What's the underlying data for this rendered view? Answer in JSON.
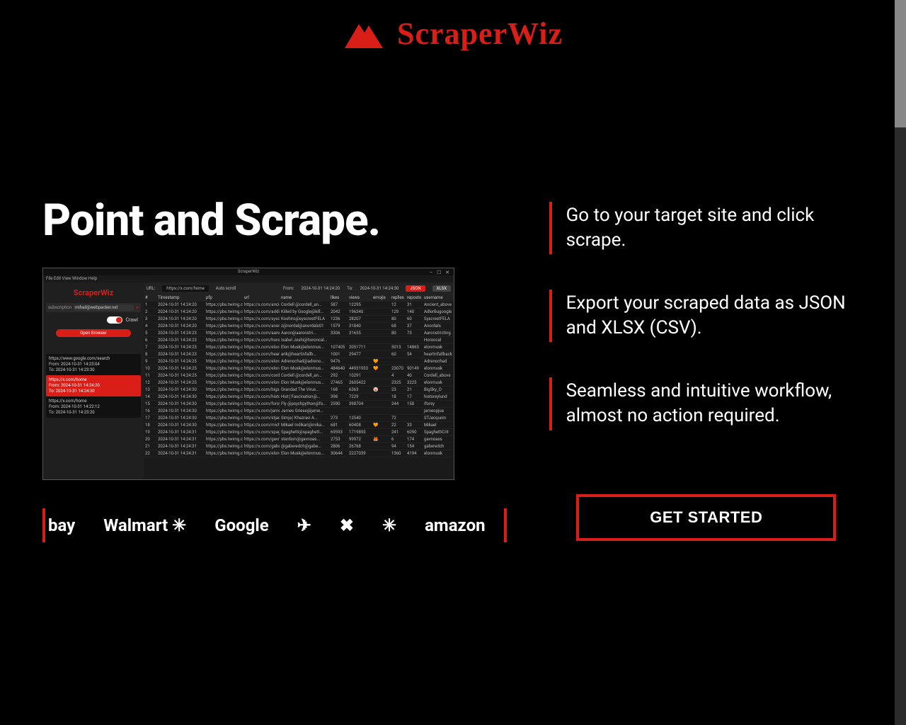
{
  "brand": {
    "name": "ScraperWiz"
  },
  "hero": {
    "title": "Point and Scrape."
  },
  "features": [
    "Go to your target site and click scrape.",
    "Export your scraped data as JSON and XLSX (CSV).",
    "Seamless and intuitive workflow, almost no action required."
  ],
  "cta": {
    "label": "GET STARTED"
  },
  "brands": [
    "bay",
    "Walmart ✳",
    "Google",
    "✈",
    "✖",
    "✳",
    "amazon"
  ],
  "screenshot": {
    "title": "ScraperWiz",
    "menubar": "File  Edit  View  Window  Help",
    "sidebar": {
      "logo": "ScraperWiz",
      "subscription_label": "subscription",
      "subscription_value": "mihail@webpacker.net",
      "toggle_label": "Crawl",
      "open_button": "Open Browser",
      "cards": [
        {
          "url": "https://www.google.com/search",
          "from": "From: 2024-10-31 14:23:04",
          "to": "To: 2024-10-31 14:23:30"
        },
        {
          "url": "https://x.com/home",
          "from": "From: 2024-10-31 14:24:20",
          "to": "To: 2024-10-31 14:24:30"
        },
        {
          "url": "https://x.com/home",
          "from": "From: 2024-10-31 14:22:12",
          "to": "To: 2024-10-31 14:23:20"
        }
      ]
    },
    "toolbar": {
      "url_label": "URL:",
      "url": "https://x.com/home",
      "auto_label": "Auto scroll",
      "from_label": "From:",
      "from": "2024-10-31 14:24:20",
      "to_label": "To:",
      "to": "2024-10-31 14:24:30",
      "json": "JSON",
      "xlsx": "XLSX"
    },
    "columns": [
      "#",
      "Timestamp",
      "pfp",
      "url",
      "name",
      "likes",
      "views",
      "emojis",
      "replies",
      "reposts",
      "username"
    ],
    "rows": [
      [
        "1",
        "2024-10-31 14:24:20",
        "https://pbs.twimg.co...",
        "https://x.com/ancient...",
        "Cordell @cordell_an...",
        "587",
        "12295",
        "",
        "12",
        "31",
        "Ancient_above"
      ],
      [
        "2",
        "2024-10-31 14:24:20",
        "https://pbs.twimg.co...",
        "https://x.com/addie...",
        "Killed by Google@kill...",
        "2042",
        "196340",
        "",
        "129",
        "140",
        "AdlerBugoogle"
      ],
      [
        "3",
        "2024-10-31 14:24:20",
        "https://pbs.twimg.co...",
        "https://x.com/syscrest...",
        "Koshiro@syscrestFELA",
        "1236",
        "28207",
        "",
        "80",
        "60",
        "SyscrestFELA"
      ],
      [
        "4",
        "2024-10-31 14:24:20",
        "https://pbs.twimg.co...",
        "https://x.com/anordals...",
        "z@nordal@anordals01",
        "1579",
        "31840",
        "",
        "68",
        "37",
        "Anordals"
      ],
      [
        "5",
        "2024-10-31 14:24:23",
        "https://pbs.twimg.co...",
        "https://x.com/aaron...",
        "Aaron@aaronstri...",
        "3306",
        "31655",
        "",
        "80",
        "73",
        "Aaronstricting"
      ],
      [
        "6",
        "2024-10-31 14:24:23",
        "https://pbs.twimg.co...",
        "https://x.com/horon_...",
        "Isabel Joshi@horoncal...",
        "",
        "",
        "",
        "",
        "",
        "Horoncal"
      ],
      [
        "7",
        "2024-10-31 14:24:23",
        "https://pbs.twimg.co...",
        "https://x.com/elonmu...",
        "Elon Musk@elonmus...",
        "107405",
        "2051711",
        "",
        "5013",
        "14863",
        "elonmusk"
      ],
      [
        "8",
        "2024-10-31 14:24:23",
        "https://pbs.twimg.co...",
        "https://x.com/heartinf...",
        "arik@heartinfallb...",
        "1001",
        "29477",
        "",
        "60",
        "54",
        "heartinfallback"
      ],
      [
        "9",
        "2024-10-31 14:24:25",
        "https://pbs.twimg.co...",
        "https://x.com/elonmu...",
        "Adrenochad@adreno...",
        "9476",
        "",
        "🧡",
        "",
        "",
        "Adrenochad"
      ],
      [
        "10",
        "2024-10-31 14:24:25",
        "https://pbs.twimg.co...",
        "https://x.com/elonmu...",
        "Elon Musk@elonmus...",
        "484640",
        "44931933",
        "🧡",
        "23070",
        "90149",
        "elonmusk"
      ],
      [
        "11",
        "2024-10-31 14:24:25",
        "https://pbs.twimg.co...",
        "https://x.com/cordell...",
        "Cordell @cordell_an...",
        "292",
        "10291",
        "",
        "4",
        "40",
        "Cordell_above"
      ],
      [
        "12",
        "2024-10-31 14:24:25",
        "https://pbs.twimg.co...",
        "https://x.com/elonmu...",
        "Elon Musk@elonmus...",
        "27465",
        "2605422",
        "",
        "2325",
        "3225",
        "elonmusk"
      ],
      [
        "13",
        "2024-10-31 14:24:30",
        "https://pbs.twimg.co...",
        "https://x.com/bigsky_d",
        "Grandad The Virus...",
        "168",
        "6363",
        "🤡",
        "23",
        "21",
        "BigSky_O"
      ],
      [
        "14",
        "2024-10-31 14:24:30",
        "https://pbs.twimg.co...",
        "https://x.com/historey...",
        "Hist│Fascination@...",
        "398",
        "7229",
        "",
        "18",
        "17",
        "historeylund"
      ],
      [
        "15",
        "2024-10-31 14:24:30",
        "https://pbs.twimg.co...",
        "https://x.com/forsyth...",
        "Fly @psychpython@fo...",
        "2590",
        "398704",
        "",
        "244",
        "158",
        "iforsy"
      ],
      [
        "16",
        "2024-10-31 14:24:30",
        "https://pbs.twimg.co...",
        "https://x.com/jameg...",
        "James Griese@jame...",
        "",
        "",
        "",
        "",
        "",
        "jameopjua"
      ],
      [
        "17",
        "2024-10-31 14:24:30",
        "https://pbs.twimg.co...",
        "https://x.com/stjacquan...",
        "Simja│Khazravi A...",
        "273",
        "12540",
        "",
        "72",
        "",
        "STJacquoin"
      ],
      [
        "18",
        "2024-10-31 14:24:30",
        "https://pbs.twimg.co...",
        "https://x.com/michaelr...",
        "Mikael Indikari@mika...",
        "681",
        "60408",
        "🧡",
        "22",
        "33",
        "Mikael"
      ],
      [
        "19",
        "2024-10-31 14:24:31",
        "https://pbs.twimg.co...",
        "https://x.com/spaghett...",
        "Spaghetti@spaghett...",
        "69593",
        "1719893",
        "",
        "241",
        "6090",
        "SpaghettiCrit"
      ],
      [
        "20",
        "2024-10-31 14:24:31",
        "https://pbs.twimg.co...",
        "https://x.com/gavnoa...",
        "stardom@gavnoas...",
        "2753",
        "99972",
        "🦊",
        "6",
        "174",
        "gavnoass"
      ],
      [
        "21",
        "2024-10-31 14:24:31",
        "https://pbs.twimg.co...",
        "https://x.com/gaberedch...",
        "@gaberedch@gabe...",
        "2806",
        "26768",
        "",
        "94",
        "154",
        "gaberedch"
      ],
      [
        "22",
        "2024-10-31 14:24:31",
        "https://pbs.twimg.co...",
        "https://x.com/elonmu...",
        "Elon Musk@elonmus...",
        "30644",
        "2227039",
        "",
        "1360",
        "4194",
        "elonmusk"
      ]
    ]
  }
}
